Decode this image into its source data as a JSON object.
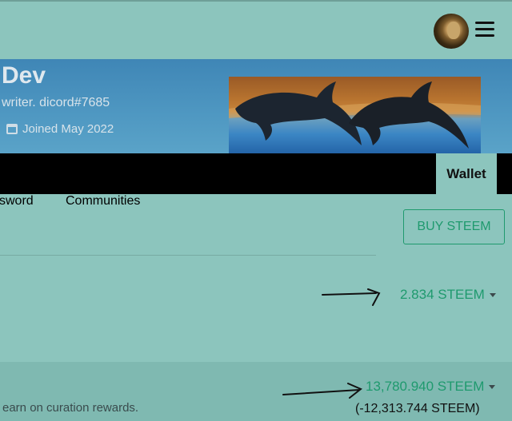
{
  "header": {
    "avatar_icon": "user-avatar",
    "menu_icon": "hamburger-menu-icon"
  },
  "profile": {
    "name": "Dev",
    "about": "writer. dicord#7685",
    "joined": "Joined May 2022"
  },
  "tabs": {
    "wallet": "Wallet"
  },
  "subnav": {
    "password": "sword",
    "communities": "Communities"
  },
  "buy_button": "BUY STEEM",
  "balances": {
    "steem": "2.834 STEEM",
    "steem_power": "13,780.940 STEEM",
    "delegated": "(-12,313.744 STEEM)",
    "sp_description": "earn on curation rewards."
  },
  "colors": {
    "background": "#8cc5bd",
    "accent": "#1f9a6e",
    "navbar": "#000000"
  }
}
